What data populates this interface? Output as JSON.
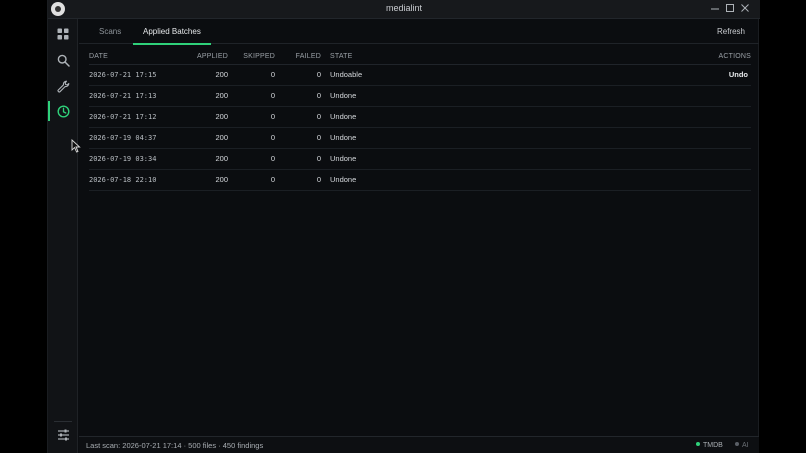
{
  "window": {
    "title": "medialint"
  },
  "titlebar": {
    "minimize_icon": "minimize-icon",
    "maximize_icon": "maximize-icon",
    "close_icon": "close-icon"
  },
  "sidebar": {
    "items": [
      {
        "name": "dashboard",
        "icon": "grid-icon",
        "active": false
      },
      {
        "name": "search",
        "icon": "search-icon",
        "active": false
      },
      {
        "name": "tools",
        "icon": "wrench-icon",
        "active": false
      },
      {
        "name": "history",
        "icon": "clock-icon",
        "active": true
      }
    ],
    "bottom_icon": "sliders-icon"
  },
  "tabs": [
    {
      "label": "Scans",
      "active": false
    },
    {
      "label": "Applied Batches",
      "active": true
    }
  ],
  "toolbar": {
    "refresh_label": "Refresh"
  },
  "table": {
    "columns": [
      "DATE",
      "APPLIED",
      "SKIPPED",
      "FAILED",
      "STATE",
      "ACTIONS"
    ],
    "rows": [
      {
        "date": "2026-07-21 17:15",
        "applied": "200",
        "skipped": "0",
        "failed": "0",
        "state": "Undoable",
        "action": "Undo"
      },
      {
        "date": "2026-07-21 17:13",
        "applied": "200",
        "skipped": "0",
        "failed": "0",
        "state": "Undone",
        "action": ""
      },
      {
        "date": "2026-07-21 17:12",
        "applied": "200",
        "skipped": "0",
        "failed": "0",
        "state": "Undone",
        "action": ""
      },
      {
        "date": "2026-07-19 04:37",
        "applied": "200",
        "skipped": "0",
        "failed": "0",
        "state": "Undone",
        "action": ""
      },
      {
        "date": "2026-07-19 03:34",
        "applied": "200",
        "skipped": "0",
        "failed": "0",
        "state": "Undone",
        "action": ""
      },
      {
        "date": "2026-07-18 22:10",
        "applied": "200",
        "skipped": "0",
        "failed": "0",
        "state": "Undone",
        "action": ""
      }
    ]
  },
  "status": {
    "text": "Last scan: 2026-07-21 17:14 · 500 files · 450 findings",
    "indicators": [
      {
        "label": "TMDB",
        "color": "#2fd17a"
      },
      {
        "label": "AI",
        "color": "#5a5f66"
      }
    ]
  },
  "colors": {
    "accent": "#2fd17a",
    "background": "#0b0d10"
  }
}
